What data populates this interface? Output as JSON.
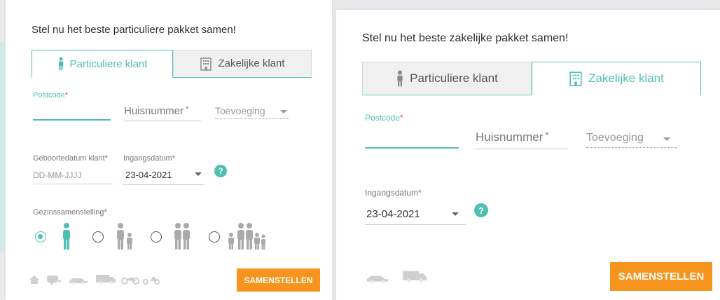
{
  "left": {
    "title": "Stel nu het beste particuliere pakket samen!",
    "tabs": [
      {
        "label": "Particuliere klant",
        "active": true
      },
      {
        "label": "Zakelijke klant",
        "active": false
      }
    ],
    "postcode": {
      "label": "Postcode",
      "required": "*",
      "value": ""
    },
    "huisnummer": {
      "placeholder": "Huisnummer",
      "required": "*"
    },
    "toevoeging": {
      "placeholder": "Toevoeging"
    },
    "geboortedatum": {
      "label": "Geboortedatum klant",
      "required": "*",
      "placeholder": "DD-MM-JJJJ"
    },
    "ingangsdatum": {
      "label": "Ingangsdatum",
      "required": "*",
      "value": "23-04-2021"
    },
    "help": "?",
    "gezin": {
      "label": "Gezinssamenstelling",
      "required": "*",
      "selected": 0
    },
    "vehicles": [
      "house-icon",
      "caravan-icon",
      "car-icon",
      "van-icon",
      "motorcycle-icon",
      "scooter-icon"
    ],
    "submit": "SAMENSTELLEN"
  },
  "right": {
    "title": "Stel nu het beste zakelijke pakket samen!",
    "tabs": [
      {
        "label": "Particuliere klant",
        "active": false
      },
      {
        "label": "Zakelijke klant",
        "active": true
      }
    ],
    "postcode": {
      "label": "Postcode",
      "required": "*",
      "value": ""
    },
    "huisnummer": {
      "placeholder": "Huisnummer",
      "required": "*"
    },
    "toevoeging": {
      "placeholder": "Toevoeging"
    },
    "ingangsdatum": {
      "label": "Ingangsdatum",
      "required": "*",
      "value": "23-04-2021"
    },
    "help": "?",
    "vehicles": [
      "car-icon",
      "van-icon"
    ],
    "submit": "SAMENSTELLEN"
  },
  "colors": {
    "accent": "#4fbfb2",
    "button": "#f7941d",
    "required": "#e04a3c"
  }
}
